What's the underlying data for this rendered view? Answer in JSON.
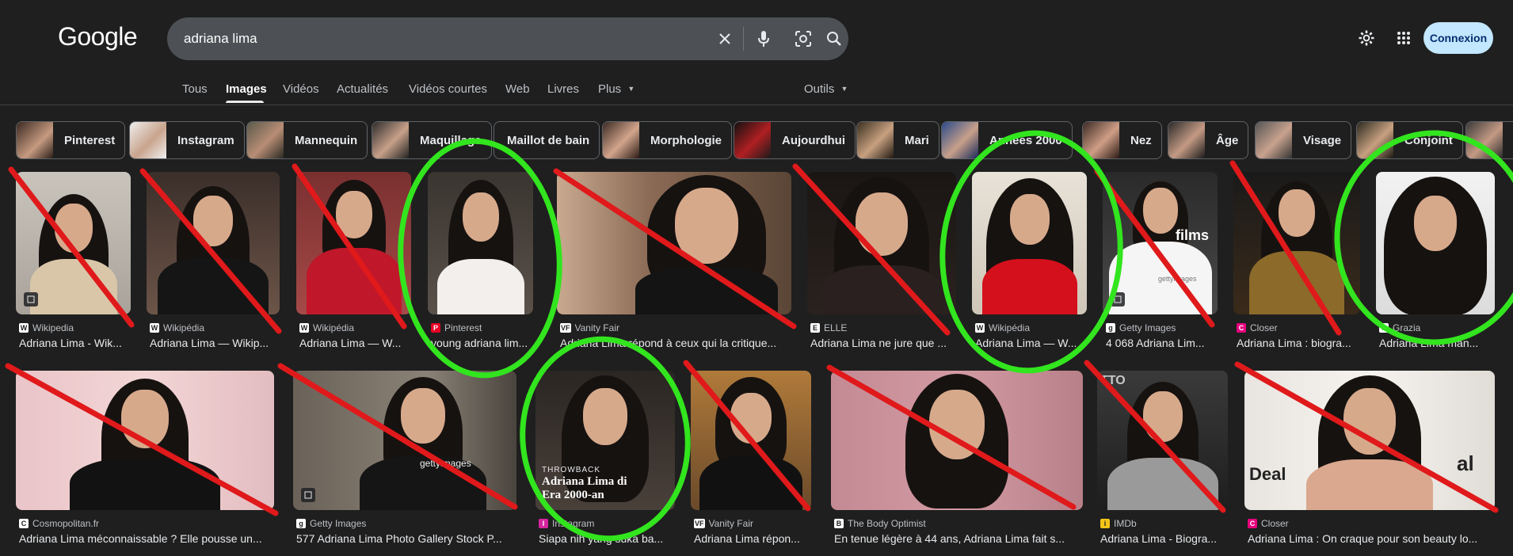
{
  "header": {
    "logo": "Google",
    "search": {
      "query": "adriana lima"
    },
    "signin_label": "Connexion"
  },
  "tabs": [
    {
      "label": "Tous"
    },
    {
      "label": "Images",
      "active": true
    },
    {
      "label": "Vidéos"
    },
    {
      "label": "Actualités"
    },
    {
      "label": "Vidéos courtes"
    },
    {
      "label": "Web"
    },
    {
      "label": "Livres"
    },
    {
      "label": "Plus"
    }
  ],
  "tools_label": "Outils",
  "chips": [
    {
      "label": "Pinterest"
    },
    {
      "label": "Instagram"
    },
    {
      "label": "Mannequin"
    },
    {
      "label": "Maquillage"
    },
    {
      "label": "Maillot de bain"
    },
    {
      "label": "Morphologie"
    },
    {
      "label": "Aujourdhui"
    },
    {
      "label": "Mari"
    },
    {
      "label": "Années 2000"
    },
    {
      "label": "Nez"
    },
    {
      "label": "Âge"
    },
    {
      "label": "Visage"
    },
    {
      "label": "Conjoint"
    }
  ],
  "results_row1": [
    {
      "source": "Wikipedia",
      "caption": "Adriana Lima - Wik...",
      "favicon": "W"
    },
    {
      "source": "Wikipédia",
      "caption": "Adriana Lima — Wikip...",
      "favicon": "W"
    },
    {
      "source": "Wikipédia",
      "caption": "Adriana Lima — W...",
      "favicon": "W"
    },
    {
      "source": "Pinterest",
      "caption": "young adriana lim...",
      "favicon": "P"
    },
    {
      "source": "Vanity Fair",
      "caption": "Adriana Lima répond à ceux qui la critique...",
      "favicon": "VF"
    },
    {
      "source": "ELLE",
      "caption": "Adriana Lima ne jure que ...",
      "favicon": "E"
    },
    {
      "source": "Wikipédia",
      "caption": "Adriana Lima — W...",
      "favicon": "W"
    },
    {
      "source": "Getty Images",
      "caption": "4 068 Adriana Lim...",
      "favicon": "g"
    },
    {
      "source": "Closer",
      "caption": "Adriana Lima : biogra...",
      "favicon": "C"
    },
    {
      "source": "Grazia",
      "caption": "Adriana Lima man...",
      "favicon": "G"
    }
  ],
  "results_row2": [
    {
      "source": "Cosmopolitan.fr",
      "caption": "Adriana Lima méconnaissable ? Elle pousse un...",
      "favicon": "C"
    },
    {
      "source": "Getty Images",
      "caption": "577 Adriana Lima Photo Gallery Stock P...",
      "favicon": "g"
    },
    {
      "source": "Instagram",
      "caption": "Siapa nih yang suka ba...",
      "favicon": "I",
      "overlay_small": "THROWBACK",
      "overlay_big": "Adriana Lima di Era 2000-an"
    },
    {
      "source": "Vanity Fair",
      "caption": "Adriana Lima répon...",
      "favicon": "VF"
    },
    {
      "source": "The Body Optimist",
      "caption": "En tenue légère à 44 ans, Adriana Lima fait s...",
      "favicon": "B"
    },
    {
      "source": "IMDb",
      "caption": "Adriana Lima - Biogra...",
      "favicon": "i"
    },
    {
      "source": "Closer",
      "caption": "Adriana Lima : On craque pour son beauty lo...",
      "favicon": "C"
    }
  ],
  "image_text": {
    "films": "films",
    "gettyimages": "gettyimages",
    "deal": "Deal",
    "al": "al",
    "tto": "TTO"
  },
  "colors": {
    "background": "#1f1f1f",
    "searchbox": "#4d5156",
    "signin_bg": "#c2e7ff",
    "strike_red": "#e0191b",
    "circle_green": "#32e51e"
  }
}
